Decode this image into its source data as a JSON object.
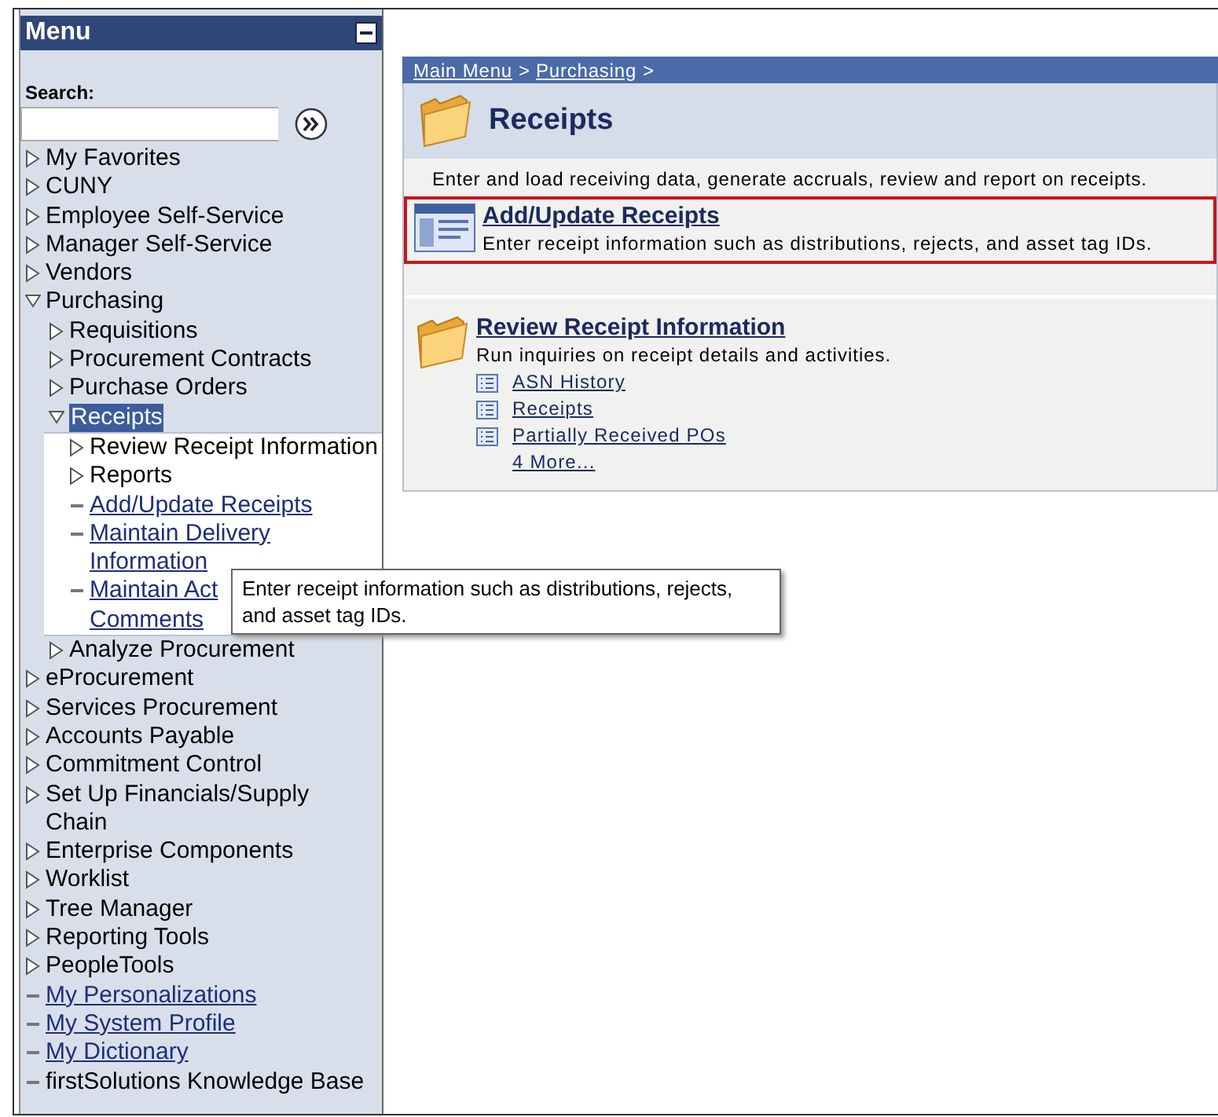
{
  "menu": {
    "title": "Menu",
    "search_label": "Search:",
    "items": [
      {
        "label": "My Favorites",
        "kind": "folder",
        "expanded": false,
        "selected": false
      },
      {
        "label": "CUNY",
        "kind": "folder",
        "expanded": false,
        "selected": false
      },
      {
        "label": "Employee Self-Service",
        "kind": "folder",
        "expanded": false,
        "selected": false
      },
      {
        "label": "Manager Self-Service",
        "kind": "folder",
        "expanded": false,
        "selected": false
      },
      {
        "label": "Vendors",
        "kind": "folder",
        "expanded": false,
        "selected": false
      },
      {
        "label": "Purchasing",
        "kind": "folder",
        "expanded": true,
        "selected": false,
        "children": [
          {
            "label": "Requisitions",
            "kind": "folder",
            "expanded": false,
            "selected": false
          },
          {
            "label": "Procurement Contracts",
            "kind": "folder",
            "expanded": false,
            "selected": false
          },
          {
            "label": "Purchase Orders",
            "kind": "folder",
            "expanded": false,
            "selected": false
          },
          {
            "label": "Receipts",
            "kind": "folder",
            "expanded": true,
            "selected": true,
            "children": [
              {
                "label": "Review Receipt Information",
                "kind": "folder",
                "expanded": false,
                "selected": false
              },
              {
                "label": "Reports",
                "kind": "folder",
                "expanded": false,
                "selected": false
              },
              {
                "label": "Add/Update Receipts",
                "kind": "link",
                "selected": false
              },
              {
                "label": "Maintain Delivery Information",
                "kind": "link",
                "selected": false
              },
              {
                "label": "Maintain Act",
                "kind": "link",
                "selected": false,
                "continuation": "Comments"
              }
            ]
          },
          {
            "label": "Analyze Procurement",
            "kind": "folder",
            "expanded": false,
            "selected": false
          }
        ]
      },
      {
        "label": "eProcurement",
        "kind": "folder",
        "expanded": false,
        "selected": false
      },
      {
        "label": "Services Procurement",
        "kind": "folder",
        "expanded": false,
        "selected": false
      },
      {
        "label": "Accounts Payable",
        "kind": "folder",
        "expanded": false,
        "selected": false
      },
      {
        "label": "Commitment Control",
        "kind": "folder",
        "expanded": false,
        "selected": false
      },
      {
        "label": "Set Up Financials/Supply Chain",
        "kind": "folder",
        "expanded": false,
        "selected": false
      },
      {
        "label": "Enterprise Components",
        "kind": "folder",
        "expanded": false,
        "selected": false
      },
      {
        "label": "Worklist",
        "kind": "folder",
        "expanded": false,
        "selected": false
      },
      {
        "label": "Tree Manager",
        "kind": "folder",
        "expanded": false,
        "selected": false
      },
      {
        "label": "Reporting Tools",
        "kind": "folder",
        "expanded": false,
        "selected": false
      },
      {
        "label": "PeopleTools",
        "kind": "folder",
        "expanded": false,
        "selected": false
      },
      {
        "label": "My Personalizations",
        "kind": "link",
        "selected": false
      },
      {
        "label": "My System Profile",
        "kind": "link",
        "selected": false
      },
      {
        "label": "My Dictionary",
        "kind": "link",
        "selected": false
      },
      {
        "label": "firstSolutions Knowledge Base",
        "kind": "plain",
        "selected": false
      }
    ]
  },
  "breadcrumb": [
    {
      "label": "Main Menu",
      "separator": ">"
    },
    {
      "label": "Purchasing",
      "separator": ">"
    }
  ],
  "page": {
    "title": "Receipts",
    "description": "Enter and load receiving data, generate accruals, review and report on receipts.",
    "sections": [
      {
        "kind": "component",
        "title": "Add/Update Receipts",
        "description": "Enter receipt information such as distributions, rejects, and asset tag IDs.",
        "highlighted": true
      },
      {
        "kind": "folder",
        "title": "Review Receipt Information",
        "description": "Run inquiries on receipt details and activities.",
        "highlighted": false,
        "links": [
          "ASN History",
          "Receipts",
          "Partially Received POs"
        ],
        "more": "4 More..."
      }
    ]
  },
  "tooltip": {
    "text": "Enter receipt information such as distributions, rejects, and asset tag IDs."
  }
}
